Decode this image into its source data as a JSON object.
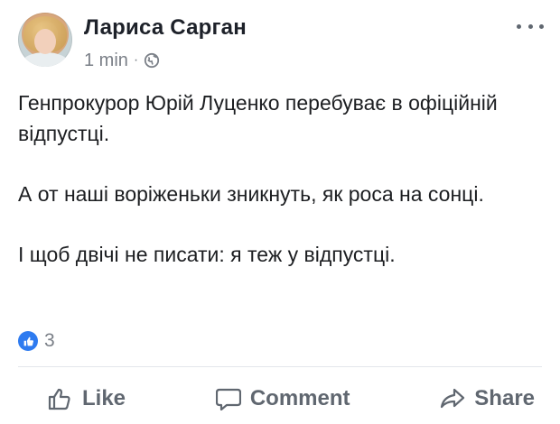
{
  "post": {
    "author": "Лариса Сарган",
    "time": "1 min",
    "separator": "·",
    "privacy_icon": "globe-icon",
    "more_icon": "ellipsis-icon",
    "paragraphs": [
      "Генпрокурор Юрій Луценко перебуває в офіційній відпустці.",
      "А от наші воріженьки зникнуть, як роса на сонці.",
      "І щоб двічі не писати: я теж у відпустці."
    ],
    "reaction_icon": "like-reaction-icon",
    "reaction_count": "3"
  },
  "actions": {
    "like_label": "Like",
    "comment_label": "Comment",
    "share_label": "Share"
  },
  "colors": {
    "accent": "#2e7bf0",
    "text": "#1c1e21",
    "muted": "#7a7f87",
    "action_gray": "#606770"
  }
}
